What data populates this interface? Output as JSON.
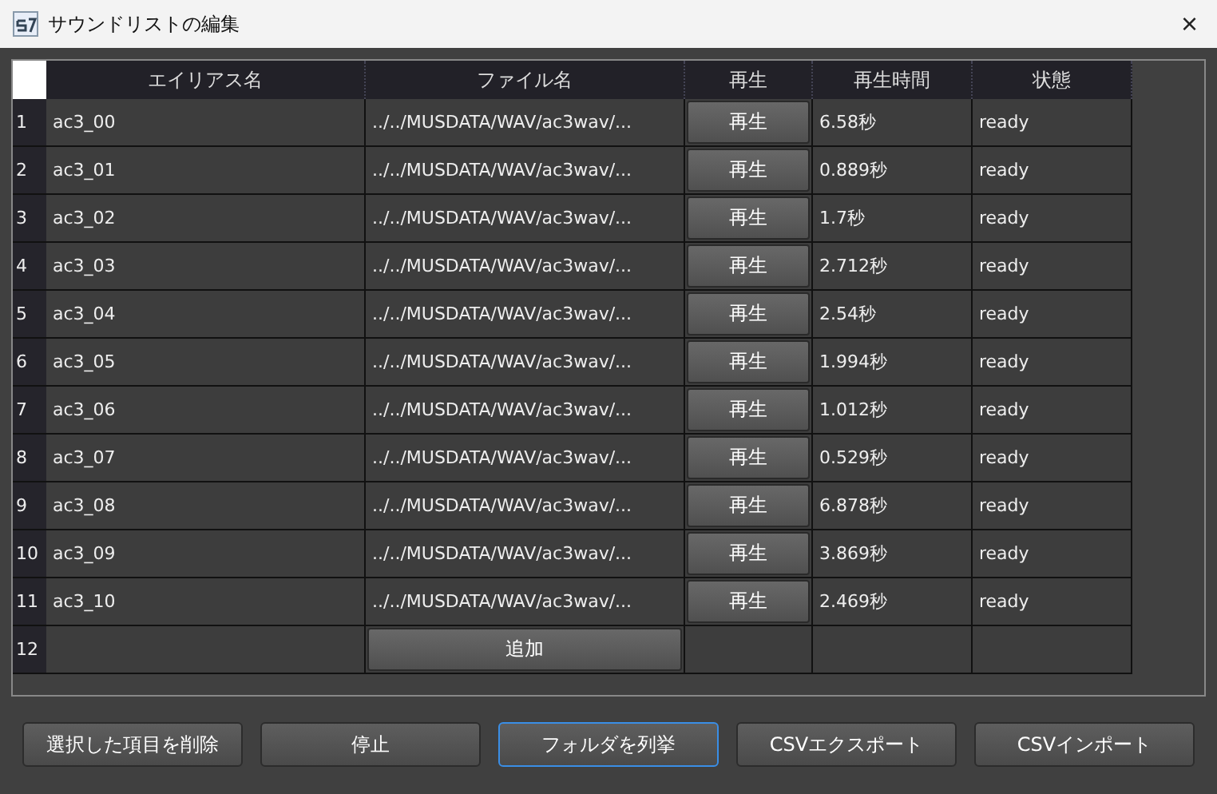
{
  "window": {
    "title": "サウンドリストの編集",
    "close": "×"
  },
  "table": {
    "columns": [
      "エイリアス名",
      "ファイル名",
      "再生",
      "再生時間",
      "状態"
    ],
    "rows": [
      {
        "index": "1",
        "alias": "ac3_00",
        "file": "../../MUSDATA/WAV/ac3wav/...",
        "play": "再生",
        "duration": "6.58秒",
        "status": "ready"
      },
      {
        "index": "2",
        "alias": "ac3_01",
        "file": "../../MUSDATA/WAV/ac3wav/...",
        "play": "再生",
        "duration": "0.889秒",
        "status": "ready"
      },
      {
        "index": "3",
        "alias": "ac3_02",
        "file": "../../MUSDATA/WAV/ac3wav/...",
        "play": "再生",
        "duration": "1.7秒",
        "status": "ready"
      },
      {
        "index": "4",
        "alias": "ac3_03",
        "file": "../../MUSDATA/WAV/ac3wav/...",
        "play": "再生",
        "duration": "2.712秒",
        "status": "ready"
      },
      {
        "index": "5",
        "alias": "ac3_04",
        "file": "../../MUSDATA/WAV/ac3wav/...",
        "play": "再生",
        "duration": "2.54秒",
        "status": "ready"
      },
      {
        "index": "6",
        "alias": "ac3_05",
        "file": "../../MUSDATA/WAV/ac3wav/...",
        "play": "再生",
        "duration": "1.994秒",
        "status": "ready"
      },
      {
        "index": "7",
        "alias": "ac3_06",
        "file": "../../MUSDATA/WAV/ac3wav/...",
        "play": "再生",
        "duration": "1.012秒",
        "status": "ready"
      },
      {
        "index": "8",
        "alias": "ac3_07",
        "file": "../../MUSDATA/WAV/ac3wav/...",
        "play": "再生",
        "duration": "0.529秒",
        "status": "ready"
      },
      {
        "index": "9",
        "alias": "ac3_08",
        "file": "../../MUSDATA/WAV/ac3wav/...",
        "play": "再生",
        "duration": "6.878秒",
        "status": "ready"
      },
      {
        "index": "10",
        "alias": "ac3_09",
        "file": "../../MUSDATA/WAV/ac3wav/...",
        "play": "再生",
        "duration": "3.869秒",
        "status": "ready"
      },
      {
        "index": "11",
        "alias": "ac3_10",
        "file": "../../MUSDATA/WAV/ac3wav/...",
        "play": "再生",
        "duration": "2.469秒",
        "status": "ready"
      }
    ],
    "add_row": {
      "index": "12",
      "button": "追加"
    }
  },
  "buttons": [
    {
      "label": "選択した項目を削除",
      "focused": false
    },
    {
      "label": "停止",
      "focused": false
    },
    {
      "label": "フォルダを列挙",
      "focused": true
    },
    {
      "label": "CSVエクスポート",
      "focused": false
    },
    {
      "label": "CSVインポート",
      "focused": false
    }
  ]
}
